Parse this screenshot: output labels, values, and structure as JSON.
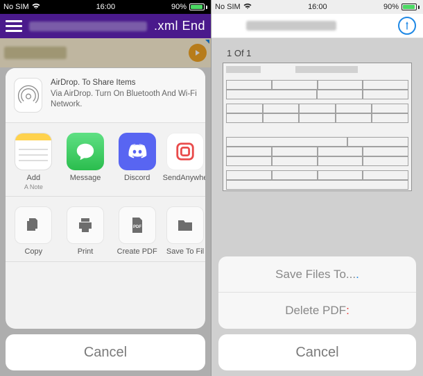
{
  "left": {
    "status": {
      "carrier": "No SIM",
      "time": "16:00",
      "battery_pct": "90%"
    },
    "header": {
      "suffix": ".xml End"
    },
    "airdrop": {
      "title": "AirDrop. To Share Items",
      "subtitle": "Via AirDrop. Turn On Bluetooth And Wi-Fi Network."
    },
    "apps": {
      "notes_label": "Add",
      "notes_sublabel": "A Note",
      "messages_label": "Message",
      "discord_label": "Discord",
      "sendanywhere_label": "SendAnywhe"
    },
    "actions": {
      "copy_label": "Copy",
      "print_label": "Print",
      "createpdf_label": "Create PDF",
      "savefiles_label": "Save To Fil"
    },
    "cancel": "Cancel"
  },
  "right": {
    "status": {
      "carrier": "No SIM",
      "time": "16:00",
      "battery_pct": "90%"
    },
    "page_indicator": "1 Of 1",
    "sheet": {
      "save_label": "Save Files To...",
      "delete_label": "Delete PDF"
    },
    "cancel": "Cancel"
  }
}
